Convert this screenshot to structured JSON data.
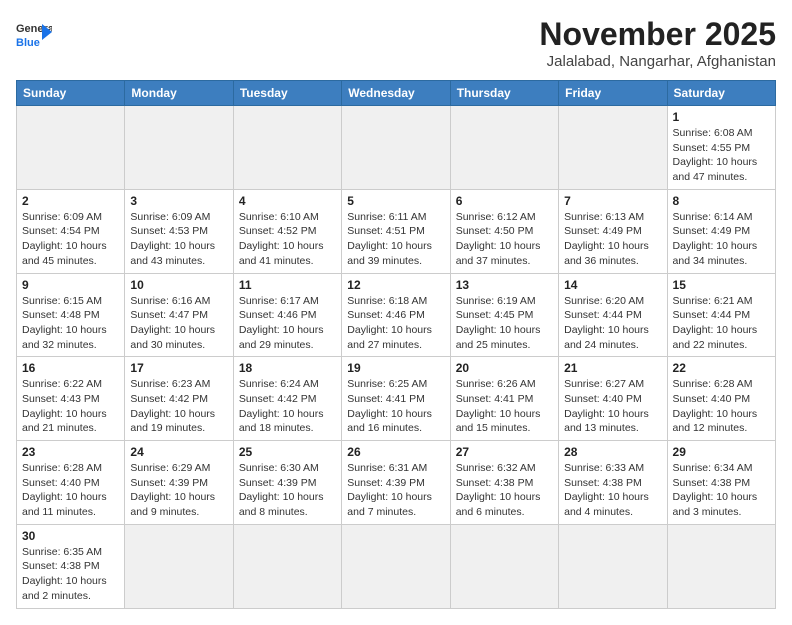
{
  "header": {
    "logo_line1": "General",
    "logo_line2": "Blue",
    "month_title": "November 2025",
    "location": "Jalalabad, Nangarhar, Afghanistan"
  },
  "weekdays": [
    "Sunday",
    "Monday",
    "Tuesday",
    "Wednesday",
    "Thursday",
    "Friday",
    "Saturday"
  ],
  "weeks": [
    [
      {
        "day": "",
        "empty": true
      },
      {
        "day": "",
        "empty": true
      },
      {
        "day": "",
        "empty": true
      },
      {
        "day": "",
        "empty": true
      },
      {
        "day": "",
        "empty": true
      },
      {
        "day": "",
        "empty": true
      },
      {
        "day": "1",
        "info": "Sunrise: 6:08 AM\nSunset: 4:55 PM\nDaylight: 10 hours and 47 minutes."
      }
    ],
    [
      {
        "day": "2",
        "info": "Sunrise: 6:09 AM\nSunset: 4:54 PM\nDaylight: 10 hours and 45 minutes."
      },
      {
        "day": "3",
        "info": "Sunrise: 6:09 AM\nSunset: 4:53 PM\nDaylight: 10 hours and 43 minutes."
      },
      {
        "day": "4",
        "info": "Sunrise: 6:10 AM\nSunset: 4:52 PM\nDaylight: 10 hours and 41 minutes."
      },
      {
        "day": "5",
        "info": "Sunrise: 6:11 AM\nSunset: 4:51 PM\nDaylight: 10 hours and 39 minutes."
      },
      {
        "day": "6",
        "info": "Sunrise: 6:12 AM\nSunset: 4:50 PM\nDaylight: 10 hours and 37 minutes."
      },
      {
        "day": "7",
        "info": "Sunrise: 6:13 AM\nSunset: 4:49 PM\nDaylight: 10 hours and 36 minutes."
      },
      {
        "day": "8",
        "info": "Sunrise: 6:14 AM\nSunset: 4:49 PM\nDaylight: 10 hours and 34 minutes."
      }
    ],
    [
      {
        "day": "9",
        "info": "Sunrise: 6:15 AM\nSunset: 4:48 PM\nDaylight: 10 hours and 32 minutes."
      },
      {
        "day": "10",
        "info": "Sunrise: 6:16 AM\nSunset: 4:47 PM\nDaylight: 10 hours and 30 minutes."
      },
      {
        "day": "11",
        "info": "Sunrise: 6:17 AM\nSunset: 4:46 PM\nDaylight: 10 hours and 29 minutes."
      },
      {
        "day": "12",
        "info": "Sunrise: 6:18 AM\nSunset: 4:46 PM\nDaylight: 10 hours and 27 minutes."
      },
      {
        "day": "13",
        "info": "Sunrise: 6:19 AM\nSunset: 4:45 PM\nDaylight: 10 hours and 25 minutes."
      },
      {
        "day": "14",
        "info": "Sunrise: 6:20 AM\nSunset: 4:44 PM\nDaylight: 10 hours and 24 minutes."
      },
      {
        "day": "15",
        "info": "Sunrise: 6:21 AM\nSunset: 4:44 PM\nDaylight: 10 hours and 22 minutes."
      }
    ],
    [
      {
        "day": "16",
        "info": "Sunrise: 6:22 AM\nSunset: 4:43 PM\nDaylight: 10 hours and 21 minutes."
      },
      {
        "day": "17",
        "info": "Sunrise: 6:23 AM\nSunset: 4:42 PM\nDaylight: 10 hours and 19 minutes."
      },
      {
        "day": "18",
        "info": "Sunrise: 6:24 AM\nSunset: 4:42 PM\nDaylight: 10 hours and 18 minutes."
      },
      {
        "day": "19",
        "info": "Sunrise: 6:25 AM\nSunset: 4:41 PM\nDaylight: 10 hours and 16 minutes."
      },
      {
        "day": "20",
        "info": "Sunrise: 6:26 AM\nSunset: 4:41 PM\nDaylight: 10 hours and 15 minutes."
      },
      {
        "day": "21",
        "info": "Sunrise: 6:27 AM\nSunset: 4:40 PM\nDaylight: 10 hours and 13 minutes."
      },
      {
        "day": "22",
        "info": "Sunrise: 6:28 AM\nSunset: 4:40 PM\nDaylight: 10 hours and 12 minutes."
      }
    ],
    [
      {
        "day": "23",
        "info": "Sunrise: 6:28 AM\nSunset: 4:40 PM\nDaylight: 10 hours and 11 minutes."
      },
      {
        "day": "24",
        "info": "Sunrise: 6:29 AM\nSunset: 4:39 PM\nDaylight: 10 hours and 9 minutes."
      },
      {
        "day": "25",
        "info": "Sunrise: 6:30 AM\nSunset: 4:39 PM\nDaylight: 10 hours and 8 minutes."
      },
      {
        "day": "26",
        "info": "Sunrise: 6:31 AM\nSunset: 4:39 PM\nDaylight: 10 hours and 7 minutes."
      },
      {
        "day": "27",
        "info": "Sunrise: 6:32 AM\nSunset: 4:38 PM\nDaylight: 10 hours and 6 minutes."
      },
      {
        "day": "28",
        "info": "Sunrise: 6:33 AM\nSunset: 4:38 PM\nDaylight: 10 hours and 4 minutes."
      },
      {
        "day": "29",
        "info": "Sunrise: 6:34 AM\nSunset: 4:38 PM\nDaylight: 10 hours and 3 minutes."
      }
    ],
    [
      {
        "day": "30",
        "info": "Sunrise: 6:35 AM\nSunset: 4:38 PM\nDaylight: 10 hours and 2 minutes."
      },
      {
        "day": "",
        "empty": true
      },
      {
        "day": "",
        "empty": true
      },
      {
        "day": "",
        "empty": true
      },
      {
        "day": "",
        "empty": true
      },
      {
        "day": "",
        "empty": true
      },
      {
        "day": "",
        "empty": true
      }
    ]
  ]
}
